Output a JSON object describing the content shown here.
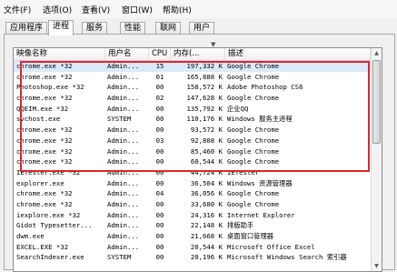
{
  "menu": {
    "items": [
      "文件(F)",
      "选项(O)",
      "查看(V)",
      "窗口(W)",
      "帮助(H)"
    ]
  },
  "tabs": [
    "应用程序",
    "进程",
    "服务",
    "性能",
    "联网",
    "用户"
  ],
  "active_tab": "进程",
  "table": {
    "headers": {
      "name": "映像名称",
      "user": "用户名",
      "cpu": "CPU",
      "mem": "内存(...",
      "desc": "描述"
    },
    "rows": [
      {
        "name": "chrome.exe *32",
        "user": "Admin...",
        "cpu": "15",
        "mem": "197,332 K",
        "desc": "Google Chrome"
      },
      {
        "name": "chrome.exe *32",
        "user": "Admin...",
        "cpu": "01",
        "mem": "165,888 K",
        "desc": "Google Chrome"
      },
      {
        "name": "Photoshop.exe *32",
        "user": "Admin...",
        "cpu": "00",
        "mem": "158,572 K",
        "desc": "Adobe Photoshop CS6"
      },
      {
        "name": "chrome.exe *32",
        "user": "Admin...",
        "cpu": "02",
        "mem": "147,628 K",
        "desc": "Google Chrome"
      },
      {
        "name": "QQEIM.exe *32",
        "user": "Admin...",
        "cpu": "00",
        "mem": "135,792 K",
        "desc": "企业QQ"
      },
      {
        "name": "svchost.exe",
        "user": "SYSTEM",
        "cpu": "00",
        "mem": "110,176 K",
        "desc": "Windows 服务主进程"
      },
      {
        "name": "chrome.exe *32",
        "user": "Admin...",
        "cpu": "00",
        "mem": "93,572 K",
        "desc": "Google Chrome"
      },
      {
        "name": "chrome.exe *32",
        "user": "Admin...",
        "cpu": "03",
        "mem": "92,808 K",
        "desc": "Google Chrome"
      },
      {
        "name": "chrome.exe *32",
        "user": "Admin...",
        "cpu": "00",
        "mem": "85,460 K",
        "desc": "Google Chrome"
      },
      {
        "name": "chrome.exe *32",
        "user": "Admin...",
        "cpu": "00",
        "mem": "60,544 K",
        "desc": "Google Chrome"
      },
      {
        "name": "IETester.exe *32",
        "user": "Admin...",
        "cpu": "00",
        "mem": "44,724 K",
        "desc": "IETester"
      },
      {
        "name": "explorer.exe",
        "user": "Admin...",
        "cpu": "00",
        "mem": "36,504 K",
        "desc": "Windows 资源管理器"
      },
      {
        "name": "chrome.exe *32",
        "user": "Admin...",
        "cpu": "04",
        "mem": "36,056 K",
        "desc": "Google Chrome"
      },
      {
        "name": "chrome.exe *32",
        "user": "Admin...",
        "cpu": "00",
        "mem": "33,680 K",
        "desc": "Google Chrome"
      },
      {
        "name": "iexplore.exe *32",
        "user": "Admin...",
        "cpu": "00",
        "mem": "24,316 K",
        "desc": "Internet Explorer"
      },
      {
        "name": "Gidot Typesetter...",
        "user": "Admin...",
        "cpu": "00",
        "mem": "22,148 K",
        "desc": "排版助手"
      },
      {
        "name": "dwm.exe",
        "user": "Admin...",
        "cpu": "00",
        "mem": "21,668 K",
        "desc": "桌面窗口管理器"
      },
      {
        "name": "EXCEL.EXE *32",
        "user": "Admin...",
        "cpu": "00",
        "mem": "20,544 K",
        "desc": "Microsoft Office Excel"
      },
      {
        "name": "SearchIndexer.exe",
        "user": "SYSTEM",
        "cpu": "00",
        "mem": "20,196 K",
        "desc": "Microsoft Windows Search 索引器"
      }
    ]
  },
  "colors": {
    "highlight": "#e0232e",
    "selected_row": "#dce9f9"
  }
}
